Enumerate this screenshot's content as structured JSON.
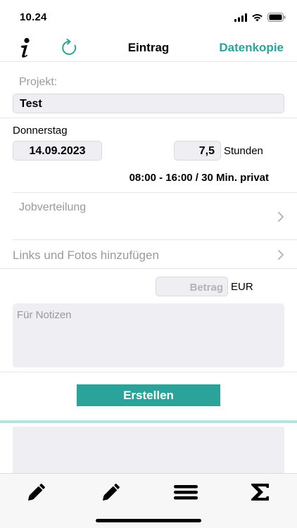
{
  "status_bar": {
    "time": "10.24"
  },
  "nav": {
    "title": "Eintrag",
    "copy_label": "Datenkopie"
  },
  "project": {
    "label": "Projekt:",
    "value": "Test"
  },
  "date": {
    "weekday": "Donnerstag",
    "value": "14.09.2023"
  },
  "hours": {
    "value": "7,5",
    "unit": "Stunden"
  },
  "time_summary": "08:00 - 16:00 / 30 Min. privat",
  "job": {
    "label": "Jobverteilung"
  },
  "links": {
    "label": "Links und Fotos hinzufügen"
  },
  "amount": {
    "placeholder": "Betrag",
    "currency": "EUR"
  },
  "notes": {
    "placeholder": "Für Notizen"
  },
  "create_button": {
    "label": "Erstellen"
  },
  "tabs": [
    {
      "icon": "pencil-icon"
    },
    {
      "icon": "pencil-icon"
    },
    {
      "icon": "menu-icon"
    },
    {
      "icon": "sigma-icon"
    }
  ],
  "colors": {
    "accent": "#2aa39b",
    "field_bg": "#eeeef3",
    "label_gray": "#9a9a9a"
  }
}
